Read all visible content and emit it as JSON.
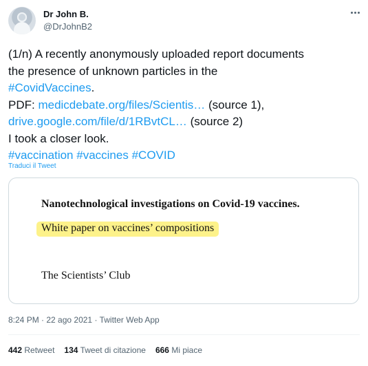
{
  "user": {
    "name": "Dr John B.",
    "handle": "@DrJohnB2"
  },
  "tweet": {
    "line1": "(1/n) A recently anonymously uploaded report documents",
    "line2": "the presence of unknown particles in the",
    "hashtag1": "#CovidVaccines",
    "hashtag1_suffix": ".",
    "pdf_prefix": "PDF: ",
    "link1": "medicdebate.org/files/Scientis…",
    "link1_suffix": " (source 1),",
    "link2": "drive.google.com/file/d/1RBvtCL…",
    "link2_suffix": " (source 2)",
    "line6": "I took a closer look.",
    "hashtags": [
      "#vaccination",
      "#vaccines",
      "#COVID"
    ]
  },
  "translate_label": "Traduci il Tweet",
  "card": {
    "title": "Nanotechnological investigations on Covid-19 vaccines.",
    "subtitle": "White paper on vaccines’ compositions",
    "author": "The Scientists’ Club",
    "highlight_color": "#fdf28a"
  },
  "meta": {
    "time": "8:24 PM",
    "date": "22 ago 2021",
    "source": "Twitter Web App",
    "separator": " · "
  },
  "stats": {
    "retweets_count": "442",
    "retweets_label": "Retweet",
    "quotes_count": "134",
    "quotes_label": "Tweet di citazione",
    "likes_count": "666",
    "likes_label": "Mi piace"
  },
  "colors": {
    "link": "#1d9bf0",
    "secondary_text": "#536471"
  }
}
